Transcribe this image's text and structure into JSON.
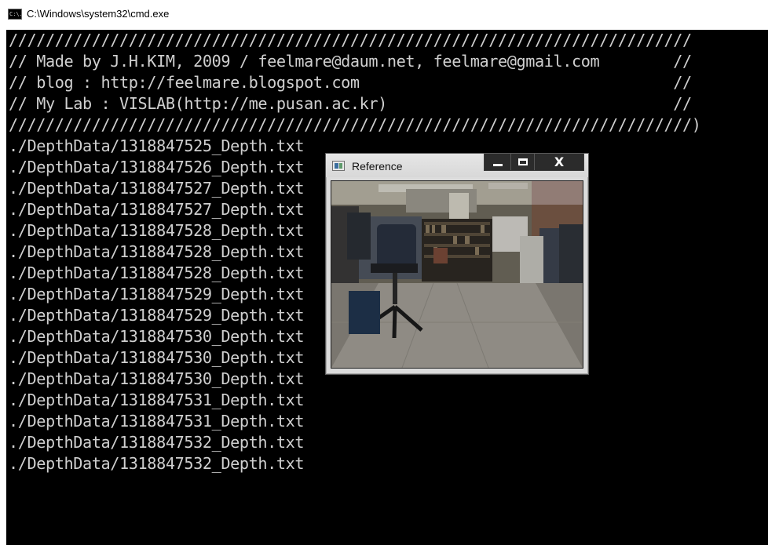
{
  "window": {
    "title": "C:\\Windows\\system32\\cmd.exe",
    "icon": "cmd-icon",
    "icon_text": "C:\\."
  },
  "console": {
    "lines": [
      "//////////////////////////////////////////////////////////////////////////",
      "// Made by J.H.KIM, 2009 / feelmare@daum.net, feelmare@gmail.com        //",
      "// blog : http://feelmare.blogspot.com                                  //",
      "// My Lab : VISLAB(http://me.pusan.ac.kr)                               //",
      "//////////////////////////////////////////////////////////////////////////)",
      "./DepthData/1318847525_Depth.txt",
      "./DepthData/1318847526_Depth.txt",
      "./DepthData/1318847527_Depth.txt",
      "./DepthData/1318847527_Depth.txt",
      "./DepthData/1318847528_Depth.txt",
      "./DepthData/1318847528_Depth.txt",
      "./DepthData/1318847528_Depth.txt",
      "./DepthData/1318847529_Depth.txt",
      "./DepthData/1318847529_Depth.txt",
      "./DepthData/1318847530_Depth.txt",
      "./DepthData/1318847530_Depth.txt",
      "./DepthData/1318847530_Depth.txt",
      "./DepthData/1318847531_Depth.txt",
      "./DepthData/1318847531_Depth.txt",
      "./DepthData/1318847532_Depth.txt",
      "./DepthData/1318847532_Depth.txt"
    ],
    "background": "#000000",
    "foreground": "#cfcfcf"
  },
  "reference_window": {
    "title": "Reference",
    "icon": "image-window-icon",
    "controls": {
      "minimize": "minimize-icon",
      "maximize": "maximize-icon",
      "close": "X"
    },
    "image": "office-room-photo"
  }
}
